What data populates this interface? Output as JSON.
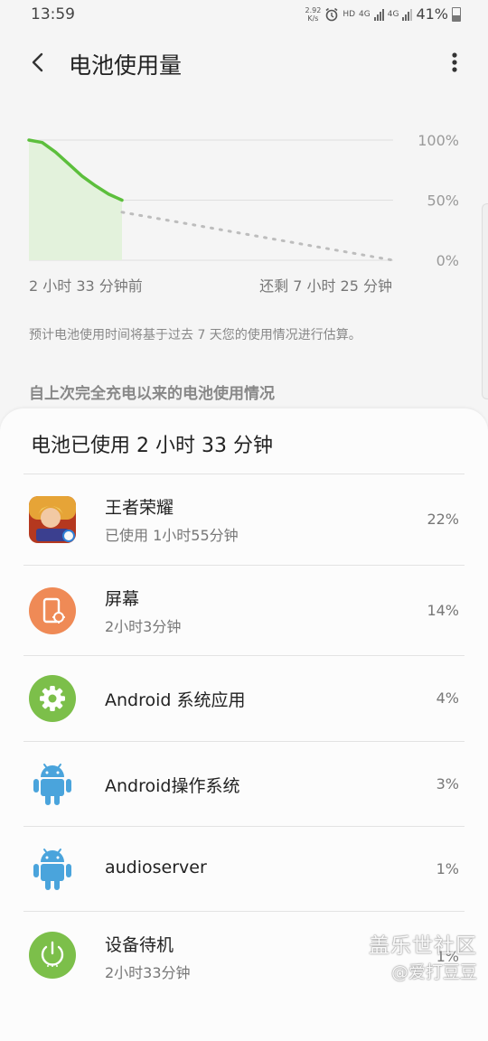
{
  "status_bar": {
    "time": "13:59",
    "speed_value": "2.92",
    "speed_unit": "K/s",
    "hd_label": "HD",
    "network_4g_1": "4G",
    "network_4g_2": "4G",
    "battery_percent": "41%"
  },
  "app_bar": {
    "title": "电池使用量",
    "back_icon": "back-arrow-icon",
    "more_icon": "more-vert-icon"
  },
  "chart_data": {
    "type": "line",
    "y_ticks": [
      "100%",
      "50%",
      "0%"
    ],
    "ylim": [
      0,
      100
    ],
    "series": [
      {
        "values": [
          100,
          98,
          90,
          80,
          70,
          62,
          55,
          50
        ],
        "style": "solid-green"
      },
      {
        "values": [
          40,
          0
        ],
        "style": "dotted-gray-projection"
      }
    ],
    "left_caption": "2 小时 33 分钟前",
    "right_caption": "还剩 7 小时 25 分钟",
    "colors": {
      "used": "#5cbf3c",
      "fill": "#e3f2dc",
      "projection": "#bdbdbd",
      "grid": "#e0e0e0"
    }
  },
  "estimate_note": "预计电池使用时间将基于过去 7 天您的使用情况进行估算。",
  "section_header": "自上次完全充电以来的电池使用情况",
  "card": {
    "title": "电池已使用 2 小时 33 分钟",
    "items": [
      {
        "name": "王者荣耀",
        "sub": "已使用 1小时55分钟",
        "percent": "22%",
        "icon": "game-king-of-glory-icon"
      },
      {
        "name": "屏幕",
        "sub": "2小时3分钟",
        "percent": "14%",
        "icon": "screen-icon"
      },
      {
        "name": "Android 系统应用",
        "sub": "",
        "percent": "4%",
        "icon": "gear-icon"
      },
      {
        "name": "Android操作系统",
        "sub": "",
        "percent": "3%",
        "icon": "android-icon"
      },
      {
        "name": "audioserver",
        "sub": "",
        "percent": "1%",
        "icon": "android-icon"
      },
      {
        "name": "设备待机",
        "sub": "2小时33分钟",
        "percent": "1%",
        "icon": "power-icon"
      }
    ]
  },
  "watermark": {
    "line1": "盖乐世社区",
    "line2": "@爱打豆豆"
  }
}
